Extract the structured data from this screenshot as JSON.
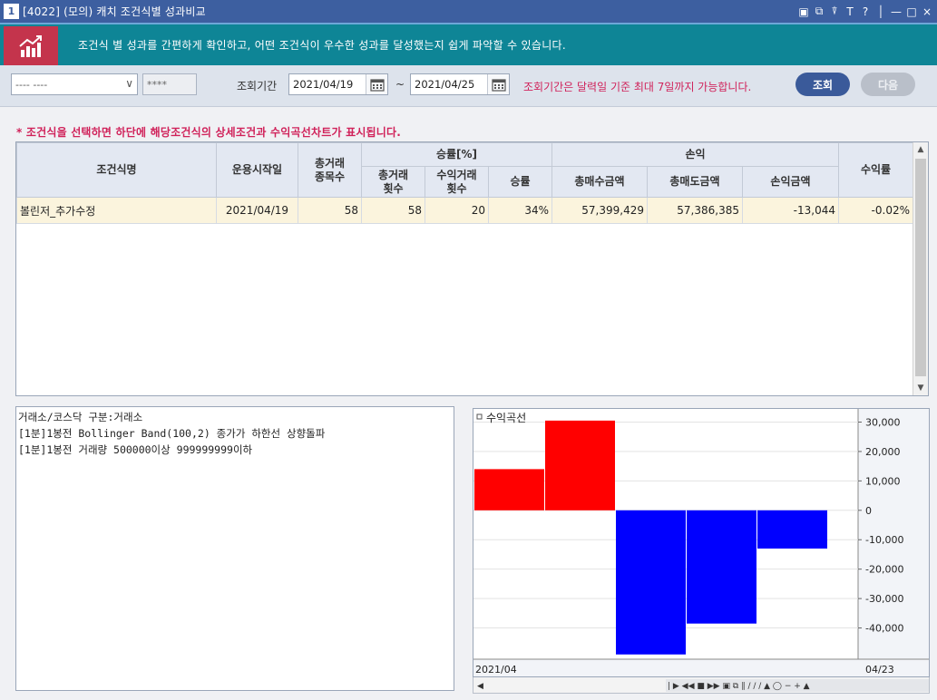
{
  "window": {
    "number": "1",
    "title": "[4022] (모의) 캐치 조건식별 성과비교",
    "controls": [
      "▣",
      "⧉",
      "⍒",
      "T",
      "?",
      "│",
      "—",
      "□",
      "×"
    ]
  },
  "banner": {
    "text": "조건식 별 성과를 간편하게 확인하고, 어떤 조건식이 우수한 성과를 달성했는지 쉽게 파악할 수 있습니다."
  },
  "filter": {
    "account_select_value": "---- ----",
    "password_mask": "****",
    "period_label": "조회기간",
    "start_date": "2021/04/19",
    "tilde": "~",
    "end_date": "2021/04/25",
    "notice": "조회기간은 달력일 기준 최대 7일까지 가능합니다.",
    "query_button": "조회",
    "next_button": "다음"
  },
  "hint": "* 조건식을 선택하면 하단에 해당조건식의 상세조건과 수익곡선차트가 표시됩니다.",
  "table": {
    "headers": {
      "name": "조건식명",
      "start": "운용시작일",
      "total_items_1": "총거래",
      "total_items_2": "종목수",
      "winrate_group": "승률[%]",
      "trades_1": "총거래",
      "trades_2": "횟수",
      "profit_trades_1": "수익거래",
      "profit_trades_2": "횟수",
      "winrate": "승률",
      "pnl_group": "손익",
      "total_buy": "총매수금액",
      "total_sell": "총매도금액",
      "pnl": "손익금액",
      "return": "수익률"
    },
    "rows": [
      {
        "name": "볼린저_추가수정",
        "start": "2021/04/19",
        "total_items": "58",
        "trades": "58",
        "profit_trades": "20",
        "winrate": "34%",
        "total_buy": "57,399,429",
        "total_sell": "57,386,385",
        "pnl": "-13,044",
        "return": "-0.02%"
      }
    ]
  },
  "detail": {
    "lines": [
      "거래소/코스닥 구분:거래소",
      "[1분]1봉전 Bollinger Band(100,2) 종가가 하한선 상향돌파",
      "[1분]1봉전 거래량 500000이상 999999999이하"
    ]
  },
  "chart_data": {
    "type": "bar",
    "title": "수익곡선",
    "values": [
      14000,
      30500,
      -49000,
      -38500,
      -13000
    ],
    "ylim": [
      -50000,
      32000
    ],
    "yticks": [
      30000,
      20000,
      10000,
      0,
      -10000,
      -20000,
      -30000,
      -40000
    ],
    "ytick_labels": [
      "30,000",
      "20,000",
      "10,000",
      "0",
      "-10,000",
      "-20,000",
      "-30,000",
      "-40,000"
    ],
    "x_start_label": "2021/04",
    "x_end_label": "04/23",
    "positive_color": "#ff0000",
    "negative_color": "#0000ff"
  }
}
